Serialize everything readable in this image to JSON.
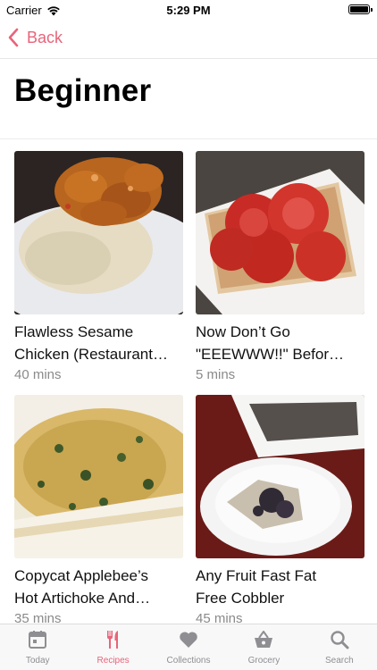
{
  "status": {
    "carrier": "Carrier",
    "time": "5:29 PM"
  },
  "nav": {
    "back_label": "Back"
  },
  "page": {
    "title": "Beginner"
  },
  "recipes": [
    {
      "line1": "Flawless Sesame",
      "line2": "Chicken (Restaurant…",
      "time": "40 mins"
    },
    {
      "line1": "Now Don’t Go",
      "line2": "\"EEEWWW!!\" Befor…",
      "time": "5 mins"
    },
    {
      "line1": "Copycat Applebee’s",
      "line2": "Hot Artichoke And…",
      "time": "35 mins"
    },
    {
      "line1": "Any Fruit Fast Fat",
      "line2": "Free Cobbler",
      "time": "45 mins"
    }
  ],
  "tabs": [
    {
      "label": "Today",
      "icon": "calendar-icon"
    },
    {
      "label": "Recipes",
      "icon": "fork-knife-icon",
      "active": true
    },
    {
      "label": "Collections",
      "icon": "heart-icon"
    },
    {
      "label": "Grocery",
      "icon": "basket-icon"
    },
    {
      "label": "Search",
      "icon": "search-icon"
    }
  ],
  "colors": {
    "accent": "#e8647a",
    "inactive": "#8e8e93"
  }
}
